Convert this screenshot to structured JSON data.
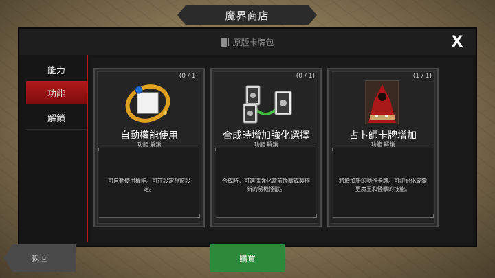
{
  "header": {
    "title": "魔界商店"
  },
  "window": {
    "pack_title": "原版卡牌包",
    "close_label": "X"
  },
  "sidebar": {
    "items": [
      {
        "label": "能力",
        "active": false
      },
      {
        "label": "功能",
        "active": true
      },
      {
        "label": "解鎖",
        "active": false
      }
    ]
  },
  "cards": [
    {
      "count": "(0 / 1)",
      "title": "自動權能使用",
      "subtitle": "功能 解鎖",
      "description": "可自動使用權能。可在設定視窗設定。",
      "icon": "auto-ring-icon"
    },
    {
      "count": "(0 / 1)",
      "title": "合成時增加強化選擇",
      "subtitle": "功能 解鎖",
      "description": "合成時，可選擇強化當前怪獸或製作新的隨機怪獸。",
      "icon": "merge-cards-icon"
    },
    {
      "count": "(1 / 1)",
      "title": "占卜師卡牌增加",
      "subtitle": "功能 解鎖",
      "description": "將增加新的動作卡牌。可初始化或變更魔王和怪獸的技能。",
      "icon": "fortune-teller-icon"
    }
  ],
  "footer": {
    "back_label": "返回",
    "buy_label": "購買"
  },
  "colors": {
    "accent_red": "#b01a1a",
    "buy_green": "#2e8a3a"
  }
}
